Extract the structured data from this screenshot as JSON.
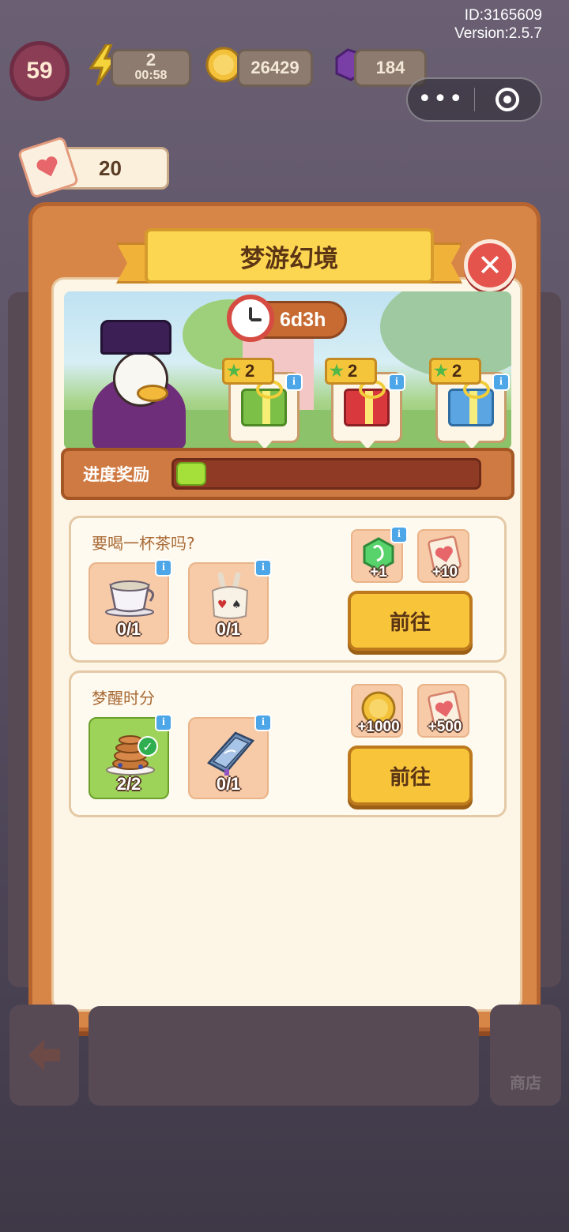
{
  "header": {
    "id_label": "ID:3165609",
    "version_label": "Version:2.5.7",
    "level": "59",
    "energy": "2",
    "energy_timer": "00:58",
    "coins": "26429",
    "gems": "184",
    "card_count": "20"
  },
  "modal": {
    "title": "梦游幻境",
    "timer": "6d3h",
    "gifts": [
      {
        "stars": "2",
        "color": "#7cc048"
      },
      {
        "stars": "2",
        "color": "#d9383d"
      },
      {
        "stars": "2",
        "color": "#5ba6e2"
      }
    ],
    "progress_label": "进度奖励",
    "progress_fraction": 0.1
  },
  "tasks": [
    {
      "title": "要喝一杯茶吗?",
      "items": [
        {
          "icon": "teacup-icon",
          "count": "0/1",
          "done": false
        },
        {
          "icon": "rabbit-cloth-icon",
          "count": "0/1",
          "done": false
        }
      ],
      "rewards": [
        {
          "icon": "green-gem-icon",
          "amount": "+1"
        },
        {
          "icon": "heart-card-icon",
          "amount": "+10"
        }
      ],
      "button": "前往"
    },
    {
      "title": "梦醒时分",
      "items": [
        {
          "icon": "pancake-stack-icon",
          "count": "2/2",
          "done": true
        },
        {
          "icon": "blue-book-icon",
          "count": "0/1",
          "done": false
        }
      ],
      "rewards": [
        {
          "icon": "gold-coin-icon",
          "amount": "+1000"
        },
        {
          "icon": "heart-card-icon",
          "amount": "+500"
        }
      ],
      "button": "前往"
    }
  ],
  "footer": {
    "shop_label": "商店"
  }
}
